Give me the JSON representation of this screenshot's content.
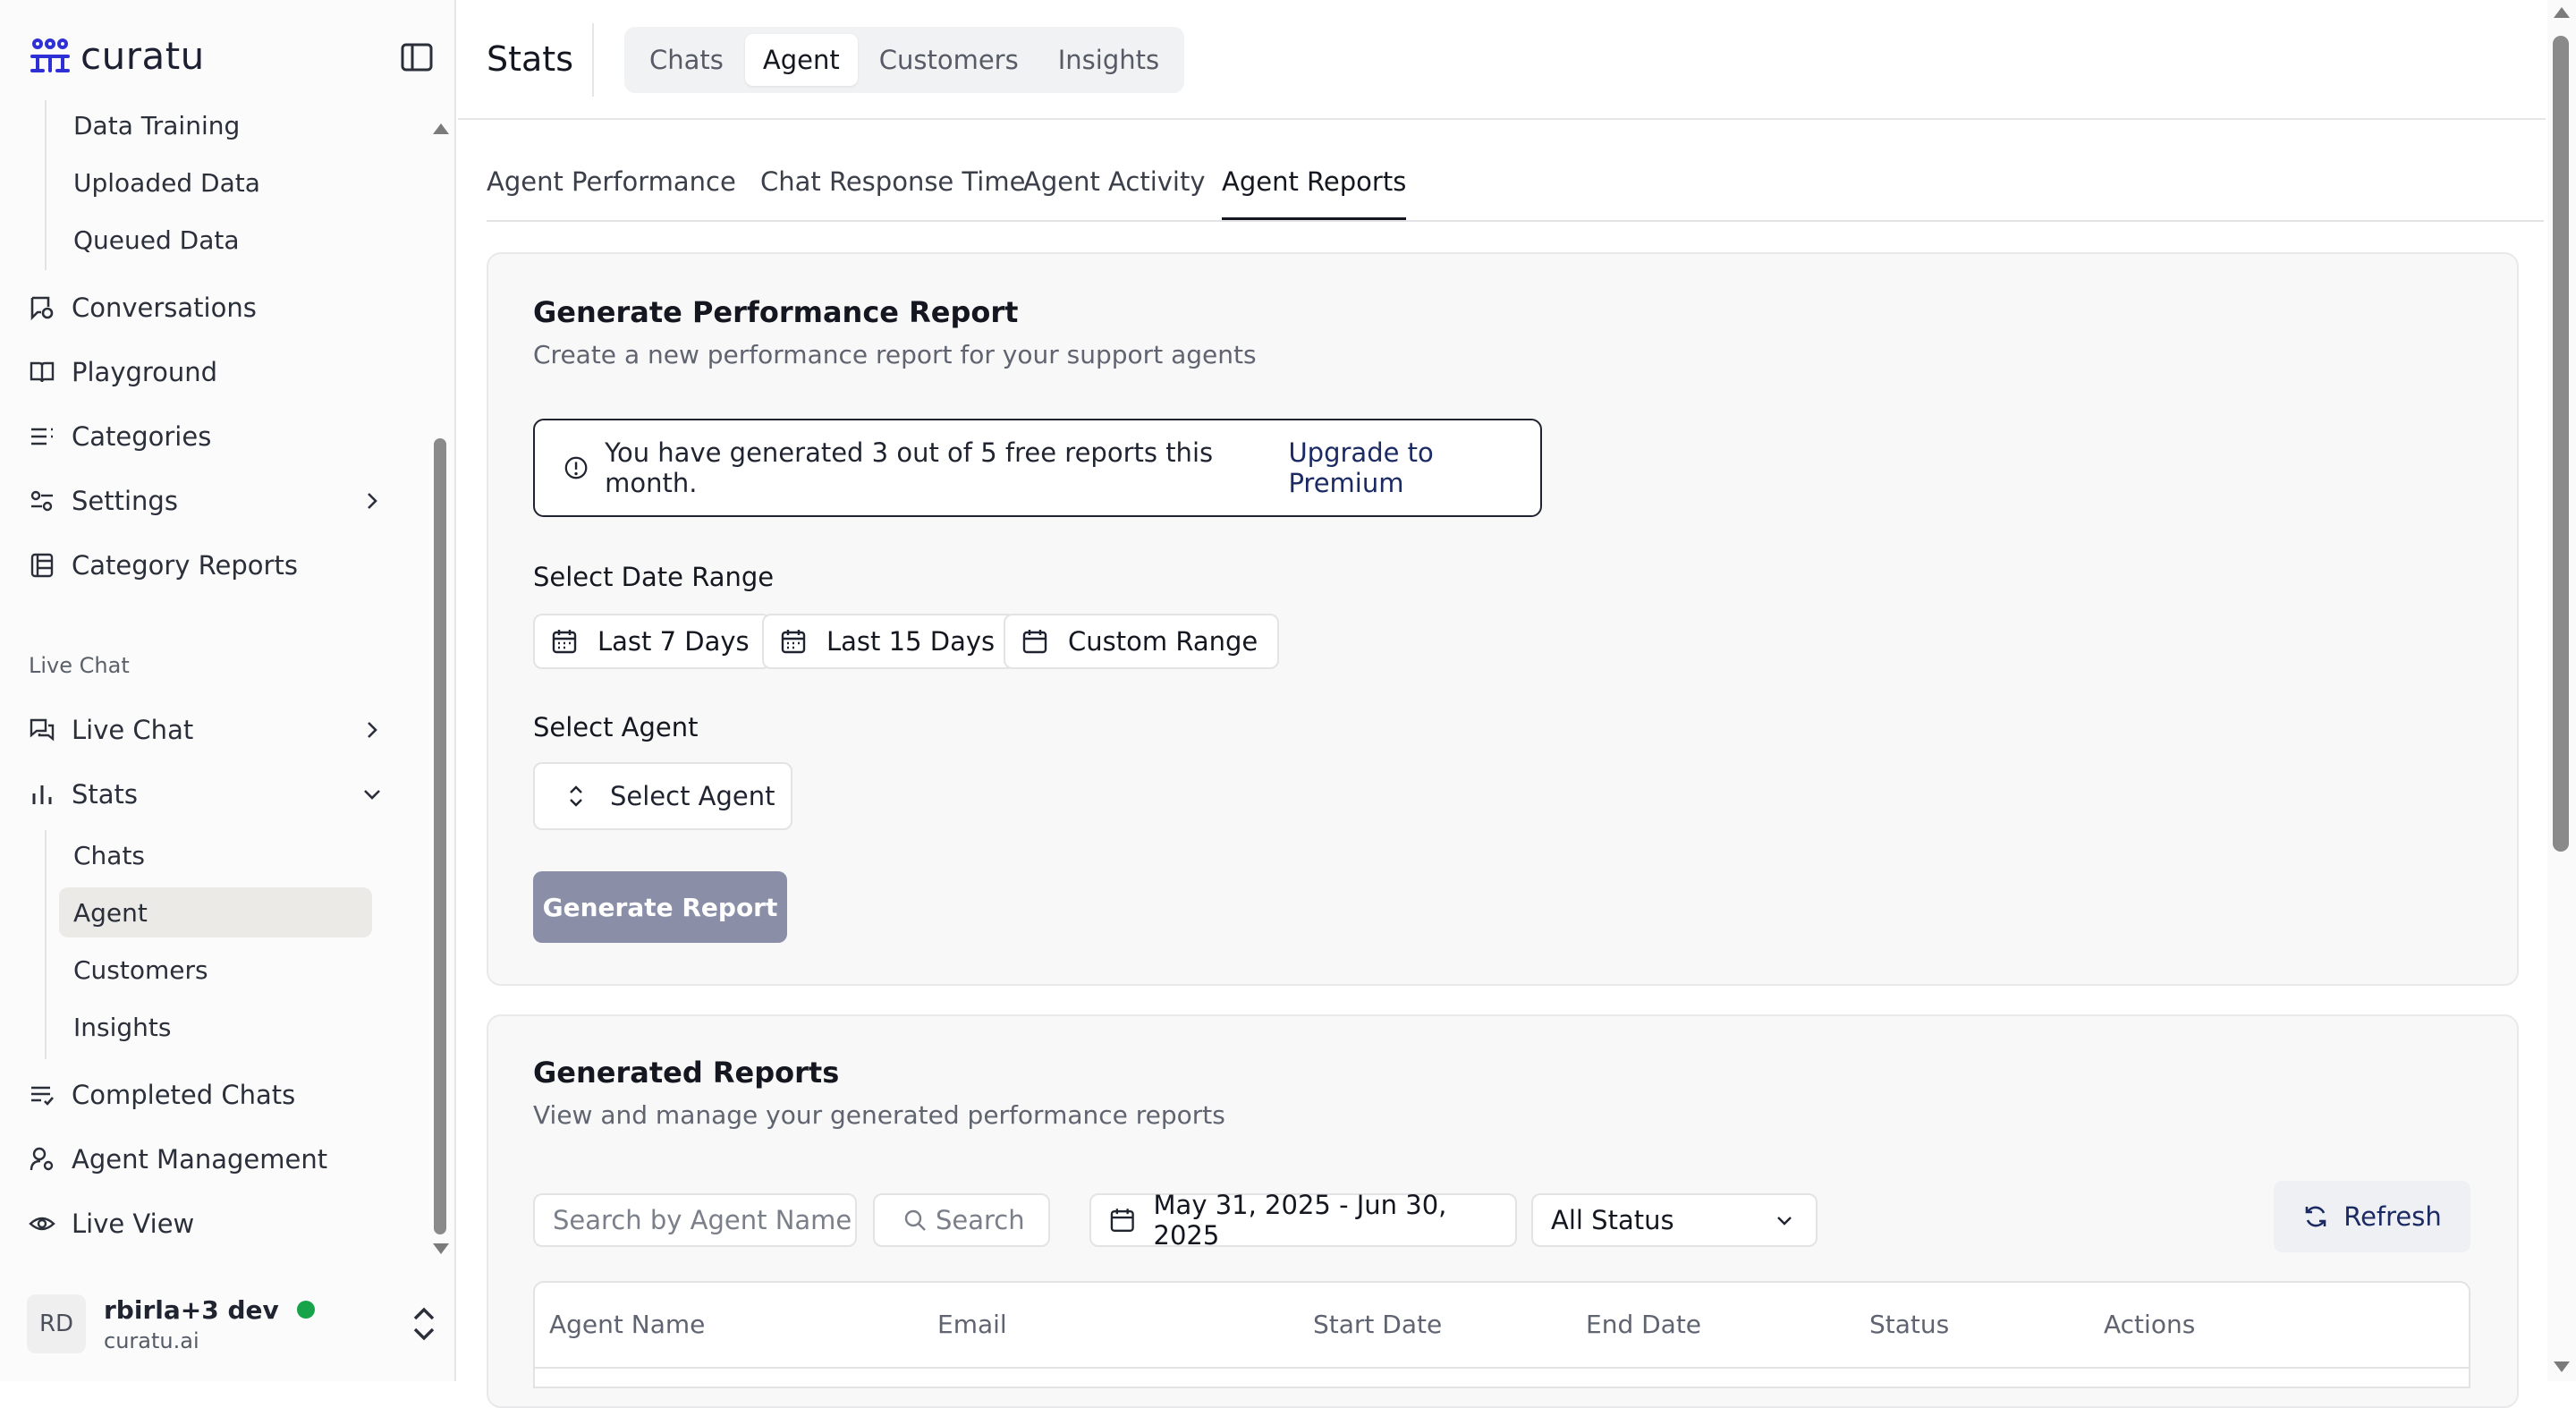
{
  "brand": {
    "name": "curatu"
  },
  "sidebar": {
    "items_top": [
      {
        "label": "Data Training",
        "icon": "none"
      },
      {
        "label": "Uploaded Data",
        "icon": "none"
      },
      {
        "label": "Queued Data",
        "icon": "none"
      }
    ],
    "items": [
      {
        "label": "Conversations",
        "icon": "conversations-icon"
      },
      {
        "label": "Playground",
        "icon": "book-icon"
      },
      {
        "label": "Categories",
        "icon": "list-icon"
      },
      {
        "label": "Settings",
        "icon": "sliders-icon"
      },
      {
        "label": "Category Reports",
        "icon": "report-icon"
      }
    ],
    "group_label": "Live Chat",
    "live_items": [
      {
        "label": "Live Chat",
        "icon": "chat-icon"
      },
      {
        "label": "Stats",
        "icon": "bar-chart-icon"
      }
    ],
    "stats_sub": [
      {
        "label": "Chats"
      },
      {
        "label": "Agent"
      },
      {
        "label": "Customers"
      },
      {
        "label": "Insights"
      }
    ],
    "bottom_items": [
      {
        "label": "Completed Chats",
        "icon": "list-check-icon"
      },
      {
        "label": "Agent Management",
        "icon": "user-cog-icon"
      },
      {
        "label": "Live View",
        "icon": "eye-icon"
      }
    ],
    "user": {
      "initials": "RD",
      "name": "rbirla+3 dev",
      "org": "curatu.ai"
    }
  },
  "header": {
    "title": "Stats",
    "tabs": [
      "Chats",
      "Agent",
      "Customers",
      "Insights"
    ],
    "active_tab": "Agent"
  },
  "subtabs": {
    "items": [
      "Agent Performance",
      "Chat Response Time",
      "Agent Activity",
      "Agent Reports"
    ],
    "active": "Agent Reports"
  },
  "generate": {
    "title": "Generate Performance Report",
    "subtitle": "Create a new performance report for your support agents",
    "notice": "You have generated 3 out of 5 free reports this month.",
    "notice_link": "Upgrade to Premium",
    "date_label": "Select Date Range",
    "ranges": [
      "Last 7 Days",
      "Last 15 Days",
      "Custom Range"
    ],
    "agent_label": "Select Agent",
    "agent_placeholder": "Select Agent",
    "button": "Generate Report",
    "button_color": "#8a8fa7"
  },
  "reports": {
    "title": "Generated Reports",
    "subtitle": "View and manage your generated performance reports",
    "search_placeholder": "Search by Agent Name",
    "search_button": "Search",
    "date_range": "May 31, 2025 - Jun 30, 2025",
    "status_filter": "All Status",
    "refresh": "Refresh",
    "columns": [
      "Agent Name",
      "Email",
      "Start Date",
      "End Date",
      "Status",
      "Actions"
    ]
  },
  "colors": {
    "online": "#16a34a",
    "brand": "#1b2a63"
  }
}
